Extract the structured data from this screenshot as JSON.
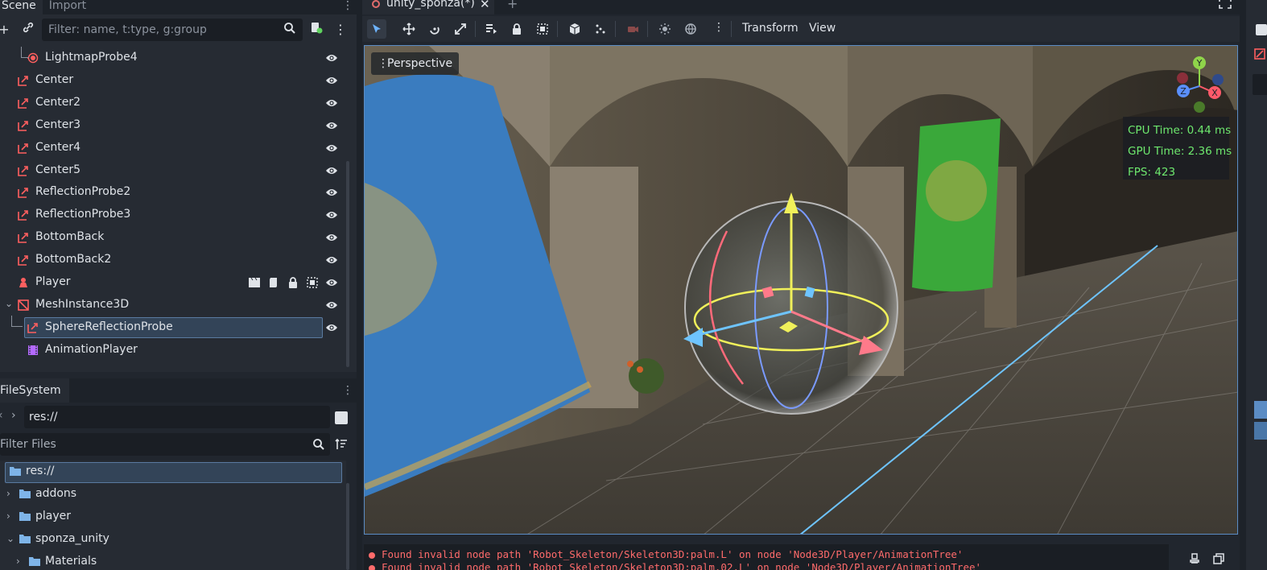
{
  "scene_dock": {
    "tabs": [
      "Scene",
      "Import"
    ],
    "filter_placeholder": "Filter: name, t:type, g:group",
    "nodes": [
      {
        "label": "LightmapProbe4",
        "icon": "lightmap-probe-icon"
      },
      {
        "label": "Center",
        "icon": "reflection-probe-icon"
      },
      {
        "label": "Center2",
        "icon": "reflection-probe-icon"
      },
      {
        "label": "Center3",
        "icon": "reflection-probe-icon"
      },
      {
        "label": "Center4",
        "icon": "reflection-probe-icon"
      },
      {
        "label": "Center5",
        "icon": "reflection-probe-icon"
      },
      {
        "label": "ReflectionProbe2",
        "icon": "reflection-probe-icon"
      },
      {
        "label": "ReflectionProbe3",
        "icon": "reflection-probe-icon"
      },
      {
        "label": "BottomBack",
        "icon": "reflection-probe-icon"
      },
      {
        "label": "BottomBack2",
        "icon": "reflection-probe-icon"
      },
      {
        "label": "Player",
        "icon": "player-scene-icon"
      },
      {
        "label": "MeshInstance3D",
        "icon": "mesh-instance-icon"
      },
      {
        "label": "SphereReflectionProbe",
        "icon": "reflection-probe-icon",
        "selected": true
      },
      {
        "label": "AnimationPlayer",
        "icon": "animation-player-icon"
      }
    ]
  },
  "filesystem": {
    "tab": "FileSystem",
    "path": "res://",
    "filter_placeholder": "Filter Files",
    "items": [
      {
        "label": "res://",
        "selected": true
      },
      {
        "label": "addons"
      },
      {
        "label": "player"
      },
      {
        "label": "sponza_unity"
      },
      {
        "label": "Materials"
      }
    ]
  },
  "editor": {
    "tab_title": "unity_sponza(*)",
    "toolbar_menus": [
      "Transform",
      "View"
    ],
    "viewport_mode": "Perspective",
    "gizmo_axes": [
      "Y",
      "X",
      "Z"
    ],
    "perf": {
      "cpu": "CPU Time: 0.44 ms",
      "gpu": "GPU Time: 2.36 ms",
      "fps": "FPS: 423"
    }
  },
  "output": {
    "lines": [
      "Found invalid node path 'Robot_Skeleton/Skeleton3D:palm.L' on node 'Node3D/Player/AnimationTree'",
      "Found invalid node path 'Robot_Skeleton/Skeleton3D:palm.02.L' on node 'Node3D/Player/AnimationTree'"
    ]
  },
  "colors": {
    "accent": "#5b8cc4",
    "error": "#ff6b6b",
    "perf_text": "#6ee86e",
    "probe_icon": "#ff5f5f"
  }
}
